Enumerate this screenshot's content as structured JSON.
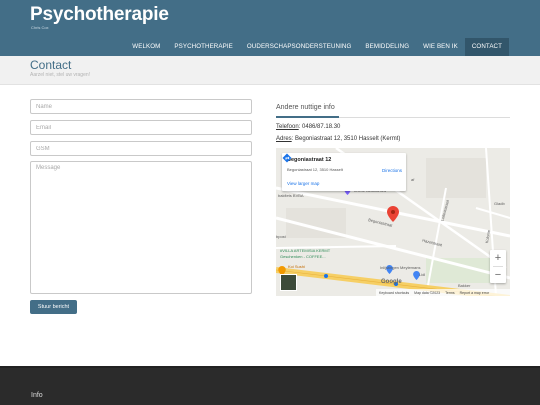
{
  "header": {
    "brand": "Psychotherapie",
    "brand_sub": "Chris Cox",
    "nav": [
      {
        "label": "WELKOM"
      },
      {
        "label": "PSYCHOTHERAPIE"
      },
      {
        "label": "OUDERSCHAPSONDERSTEUNING"
      },
      {
        "label": "BEMIDDELING"
      },
      {
        "label": "WIE BEN IK"
      },
      {
        "label": "CONTACT",
        "active": true
      }
    ]
  },
  "page": {
    "title": "Contact",
    "subtitle": "Aarzel niet, stel uw vragen!"
  },
  "form": {
    "name_placeholder": "Name",
    "email_placeholder": "Email",
    "gsm_placeholder": "GSM",
    "message_placeholder": "Message",
    "submit_label": "Stuur bericht"
  },
  "side": {
    "title": "Andere nuttige info",
    "phone_label": "Telefoon",
    "phone_value": ": 0486/87.18.30",
    "address_label": "Adres",
    "address_value": ": Begoniastraat 12, 3510 Hasselt (Kermt)"
  },
  "map": {
    "card_title": "Begoniastraat 12",
    "card_address": "Begoniastraat 12, 3510 Hasselt",
    "directions": "Directions",
    "larger_map": "View larger map",
    "labels": {
      "l1": "Imene Belkhamed",
      "l2": "bakfiets BVBA",
      "l3": "Begoniastraat",
      "l4": "Lelieststraat",
      "l5": "Hazelstraat",
      "l6": "Gladb",
      "l7": "Kolonie",
      "l8": "#VILLA ARTEMISIA KERMT",
      "l9": "Geschenken - COFFEE...",
      "l10": "Koi Sushi",
      "l11": "Inlijstingen Meylemans",
      "l12": "Lidl",
      "l13": "Bakker",
      "l14": "bpost",
      "l15": "af"
    },
    "google": "Google",
    "footer_items": [
      "Keyboard shortcuts",
      "Map data ©2023",
      "Terms",
      "Report a map error"
    ],
    "colors": {
      "pin": "#ea4335",
      "road_major": "#f6cf65",
      "road_minor": "#ffffff",
      "link": "#1a73e8"
    }
  },
  "footer": {
    "title": "Info"
  }
}
